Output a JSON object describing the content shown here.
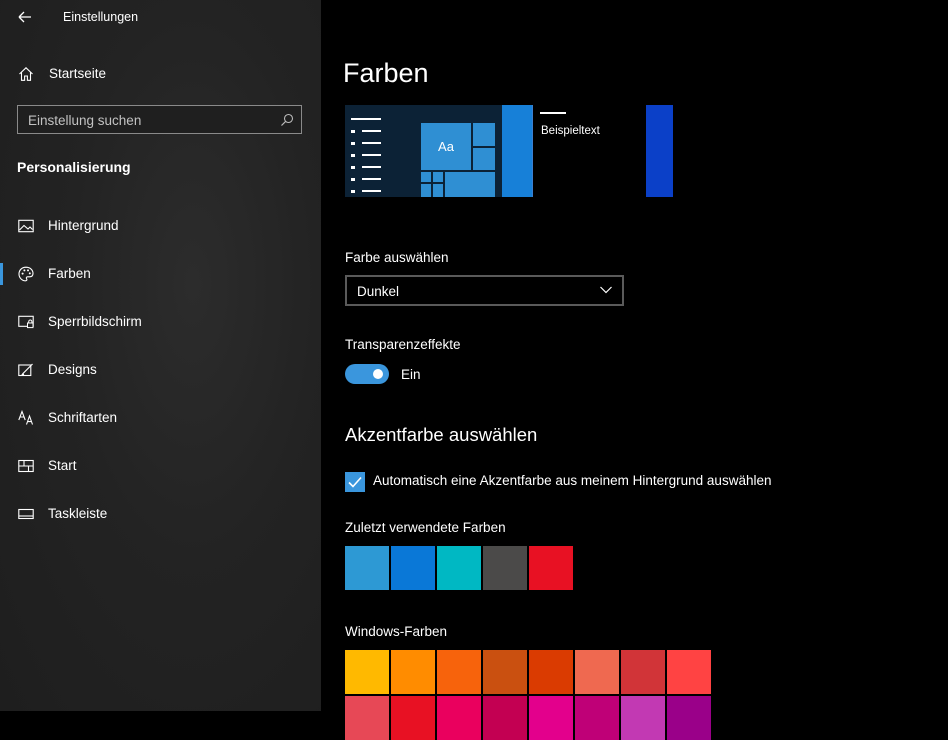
{
  "window": {
    "title": "Einstellungen"
  },
  "sidebar": {
    "home_label": "Startseite",
    "search_placeholder": "Einstellung suchen",
    "section_title": "Personalisierung",
    "items": [
      {
        "label": "Hintergrund",
        "icon": "image-icon",
        "selected": false
      },
      {
        "label": "Farben",
        "icon": "palette-icon",
        "selected": true
      },
      {
        "label": "Sperrbildschirm",
        "icon": "lock-screen-icon",
        "selected": false
      },
      {
        "label": "Designs",
        "icon": "themes-icon",
        "selected": false
      },
      {
        "label": "Schriftarten",
        "icon": "fonts-icon",
        "selected": false
      },
      {
        "label": "Start",
        "icon": "start-icon",
        "selected": false
      },
      {
        "label": "Taskleiste",
        "icon": "taskbar-icon",
        "selected": false
      }
    ]
  },
  "main": {
    "title": "Farben",
    "preview": {
      "tile_text": "Aa",
      "sample_text": "Beispieltext"
    },
    "color_mode": {
      "label": "Farbe auswählen",
      "value": "Dunkel"
    },
    "transparency": {
      "label": "Transparenzeffekte",
      "state": "Ein",
      "on": true
    },
    "accent": {
      "heading": "Akzentfarbe auswählen",
      "auto_label": "Automatisch eine Akzentfarbe aus meinem Hintergrund auswählen",
      "auto_checked": true,
      "recent_label": "Zuletzt verwendete Farben",
      "recent_colors": [
        "#2d99d4",
        "#0a78d7",
        "#00b8c3",
        "#4b4a49",
        "#e81123"
      ],
      "windows_label": "Windows-Farben",
      "windows_colors_row1": [
        "#ffb900",
        "#ff8c00",
        "#f7630c",
        "#ca5010",
        "#da3b01",
        "#ef6950",
        "#d13438",
        "#ff4343"
      ],
      "windows_colors_row2": [
        "#e74856",
        "#e81123",
        "#ea005e",
        "#c30052",
        "#e3008c",
        "#bf0077",
        "#c239b3",
        "#9a0089"
      ]
    }
  },
  "colors": {
    "accent": "#3a96dd",
    "sidebar_bg": "#232323",
    "main_bg": "#000000"
  }
}
